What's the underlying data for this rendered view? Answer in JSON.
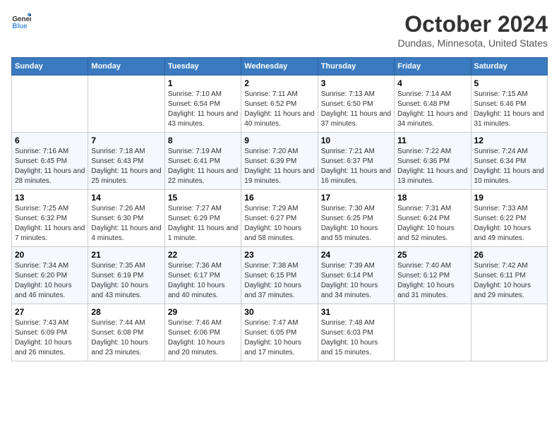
{
  "header": {
    "logo_general": "General",
    "logo_blue": "Blue",
    "title": "October 2024",
    "subtitle": "Dundas, Minnesota, United States"
  },
  "days_of_week": [
    "Sunday",
    "Monday",
    "Tuesday",
    "Wednesday",
    "Thursday",
    "Friday",
    "Saturday"
  ],
  "weeks": [
    [
      {
        "day": "",
        "info": ""
      },
      {
        "day": "",
        "info": ""
      },
      {
        "day": "1",
        "info": "Sunrise: 7:10 AM\nSunset: 6:54 PM\nDaylight: 11 hours and 43 minutes."
      },
      {
        "day": "2",
        "info": "Sunrise: 7:11 AM\nSunset: 6:52 PM\nDaylight: 11 hours and 40 minutes."
      },
      {
        "day": "3",
        "info": "Sunrise: 7:13 AM\nSunset: 6:50 PM\nDaylight: 11 hours and 37 minutes."
      },
      {
        "day": "4",
        "info": "Sunrise: 7:14 AM\nSunset: 6:48 PM\nDaylight: 11 hours and 34 minutes."
      },
      {
        "day": "5",
        "info": "Sunrise: 7:15 AM\nSunset: 6:46 PM\nDaylight: 11 hours and 31 minutes."
      }
    ],
    [
      {
        "day": "6",
        "info": "Sunrise: 7:16 AM\nSunset: 6:45 PM\nDaylight: 11 hours and 28 minutes."
      },
      {
        "day": "7",
        "info": "Sunrise: 7:18 AM\nSunset: 6:43 PM\nDaylight: 11 hours and 25 minutes."
      },
      {
        "day": "8",
        "info": "Sunrise: 7:19 AM\nSunset: 6:41 PM\nDaylight: 11 hours and 22 minutes."
      },
      {
        "day": "9",
        "info": "Sunrise: 7:20 AM\nSunset: 6:39 PM\nDaylight: 11 hours and 19 minutes."
      },
      {
        "day": "10",
        "info": "Sunrise: 7:21 AM\nSunset: 6:37 PM\nDaylight: 11 hours and 16 minutes."
      },
      {
        "day": "11",
        "info": "Sunrise: 7:22 AM\nSunset: 6:36 PM\nDaylight: 11 hours and 13 minutes."
      },
      {
        "day": "12",
        "info": "Sunrise: 7:24 AM\nSunset: 6:34 PM\nDaylight: 11 hours and 10 minutes."
      }
    ],
    [
      {
        "day": "13",
        "info": "Sunrise: 7:25 AM\nSunset: 6:32 PM\nDaylight: 11 hours and 7 minutes."
      },
      {
        "day": "14",
        "info": "Sunrise: 7:26 AM\nSunset: 6:30 PM\nDaylight: 11 hours and 4 minutes."
      },
      {
        "day": "15",
        "info": "Sunrise: 7:27 AM\nSunset: 6:29 PM\nDaylight: 11 hours and 1 minute."
      },
      {
        "day": "16",
        "info": "Sunrise: 7:29 AM\nSunset: 6:27 PM\nDaylight: 10 hours and 58 minutes."
      },
      {
        "day": "17",
        "info": "Sunrise: 7:30 AM\nSunset: 6:25 PM\nDaylight: 10 hours and 55 minutes."
      },
      {
        "day": "18",
        "info": "Sunrise: 7:31 AM\nSunset: 6:24 PM\nDaylight: 10 hours and 52 minutes."
      },
      {
        "day": "19",
        "info": "Sunrise: 7:33 AM\nSunset: 6:22 PM\nDaylight: 10 hours and 49 minutes."
      }
    ],
    [
      {
        "day": "20",
        "info": "Sunrise: 7:34 AM\nSunset: 6:20 PM\nDaylight: 10 hours and 46 minutes."
      },
      {
        "day": "21",
        "info": "Sunrise: 7:35 AM\nSunset: 6:19 PM\nDaylight: 10 hours and 43 minutes."
      },
      {
        "day": "22",
        "info": "Sunrise: 7:36 AM\nSunset: 6:17 PM\nDaylight: 10 hours and 40 minutes."
      },
      {
        "day": "23",
        "info": "Sunrise: 7:38 AM\nSunset: 6:15 PM\nDaylight: 10 hours and 37 minutes."
      },
      {
        "day": "24",
        "info": "Sunrise: 7:39 AM\nSunset: 6:14 PM\nDaylight: 10 hours and 34 minutes."
      },
      {
        "day": "25",
        "info": "Sunrise: 7:40 AM\nSunset: 6:12 PM\nDaylight: 10 hours and 31 minutes."
      },
      {
        "day": "26",
        "info": "Sunrise: 7:42 AM\nSunset: 6:11 PM\nDaylight: 10 hours and 29 minutes."
      }
    ],
    [
      {
        "day": "27",
        "info": "Sunrise: 7:43 AM\nSunset: 6:09 PM\nDaylight: 10 hours and 26 minutes."
      },
      {
        "day": "28",
        "info": "Sunrise: 7:44 AM\nSunset: 6:08 PM\nDaylight: 10 hours and 23 minutes."
      },
      {
        "day": "29",
        "info": "Sunrise: 7:46 AM\nSunset: 6:06 PM\nDaylight: 10 hours and 20 minutes."
      },
      {
        "day": "30",
        "info": "Sunrise: 7:47 AM\nSunset: 6:05 PM\nDaylight: 10 hours and 17 minutes."
      },
      {
        "day": "31",
        "info": "Sunrise: 7:48 AM\nSunset: 6:03 PM\nDaylight: 10 hours and 15 minutes."
      },
      {
        "day": "",
        "info": ""
      },
      {
        "day": "",
        "info": ""
      }
    ]
  ]
}
